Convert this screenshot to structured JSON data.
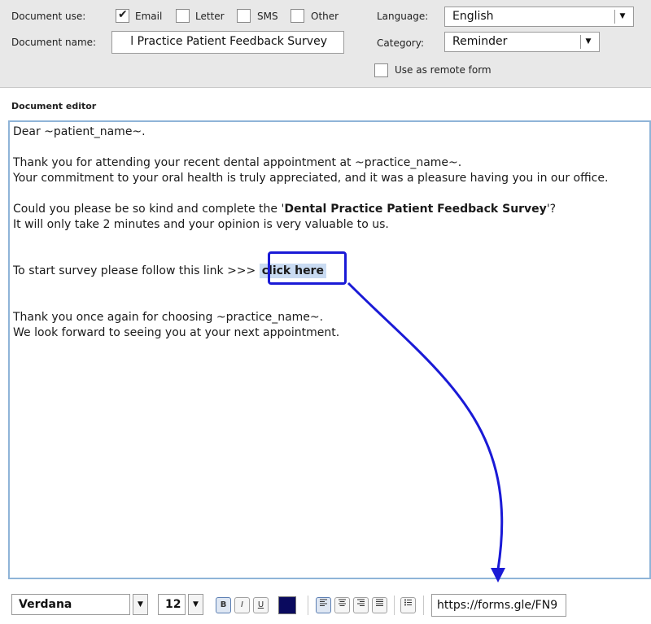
{
  "header": {
    "document_use_label": "Document use:",
    "options": [
      {
        "label": "Email",
        "checked": true
      },
      {
        "label": "Letter",
        "checked": false
      },
      {
        "label": "SMS",
        "checked": false
      },
      {
        "label": "Other",
        "checked": false
      }
    ],
    "document_name_label": "Document name:",
    "document_name_value": "Dental Practice Patient Feedback Survey",
    "document_name_visible": "l Practice Patient Feedback Survey",
    "language_label": "Language:",
    "language_value": "English",
    "category_label": "Category:",
    "category_value": "Reminder",
    "remote_form_label": "Use as remote form",
    "remote_form_checked": false
  },
  "editor": {
    "title": "Document editor",
    "greeting": "Dear ~patient_name~.",
    "para1_line1": "Thank you  for attending your recent dental appointment at  ~practice_name~.",
    "para1_line2": "Your commitment to your oral health is truly appreciated, and it was a pleasure having you in our office.",
    "para2_pre": "Could you please  be so kind and complete the '",
    "para2_bold": "Dental Practice Patient Feedback Survey",
    "para2_post": "'?",
    "para2_line2": "It will only take 2 minutes and your opinion is very valuable to us.",
    "link_pre": "To start survey please follow this link  >>> ",
    "link_text": "click here",
    "closing_line1": "Thank you once again for choosing ~practice_name~.",
    "closing_line2": "We look forward to seeing you at your next appointment."
  },
  "toolbar": {
    "font": "Verdana",
    "size": "12",
    "bold": "B",
    "italic": "I",
    "underline": "U",
    "text_color": "#0a0a5e",
    "link_url": "https://forms.gle/FN9"
  },
  "annotation": {
    "color": "#1a1ad6"
  }
}
